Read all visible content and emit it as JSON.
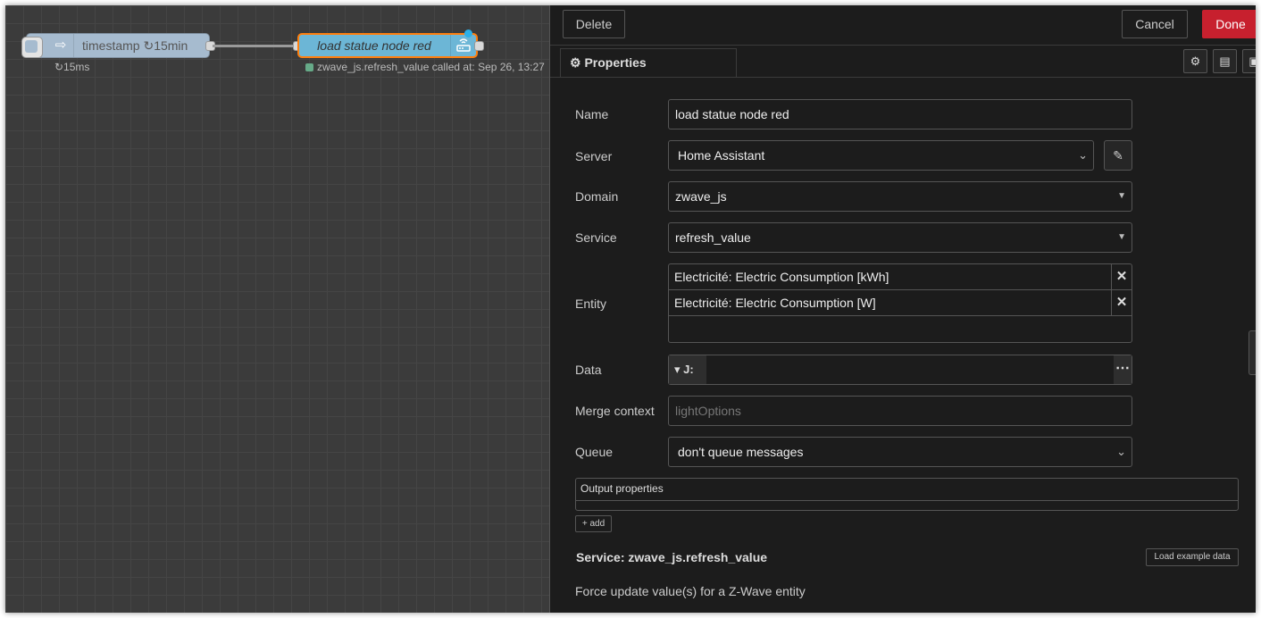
{
  "flow": {
    "inject_node": {
      "label": "timestamp ↻15min",
      "icon": "inject-arrow-icon",
      "status": "↻15ms"
    },
    "service_node": {
      "label": "load statue node red",
      "icon": "router-icon",
      "status": "zwave_js.refresh_value called at: Sep 26, 13:27"
    }
  },
  "toolbar": {
    "delete_label": "Delete",
    "cancel_label": "Cancel",
    "done_label": "Done"
  },
  "tabs": {
    "properties_label": "Properties",
    "icons": [
      "gear-icon",
      "description-icon",
      "appearance-icon"
    ]
  },
  "form": {
    "name": {
      "label": "Name",
      "value": "load statue node red"
    },
    "server": {
      "label": "Server",
      "value": "Home Assistant"
    },
    "domain": {
      "label": "Domain",
      "value": "zwave_js"
    },
    "service": {
      "label": "Service",
      "value": "refresh_value"
    },
    "entity": {
      "label": "Entity",
      "items": [
        "Electricité: Electric Consumption [kWh]",
        "Electricité: Electric Consumption [W]"
      ]
    },
    "data": {
      "label": "Data",
      "type_glyph": "J:"
    },
    "merge_context": {
      "label": "Merge context",
      "placeholder": "lightOptions"
    },
    "queue": {
      "label": "Queue",
      "value": "don't queue messages"
    },
    "output_properties": {
      "label": "Output properties",
      "add_label": "add"
    }
  },
  "service_info": {
    "title": "Service: zwave_js.refresh_value",
    "load_example_label": "Load example data",
    "description": "Force update value(s) for a Z-Wave entity"
  },
  "colors": {
    "done": "#c7202e",
    "service_node": "#6cb6d6",
    "inject_node": "#a6bbcf",
    "selected_outline": "#ff7f0e"
  }
}
